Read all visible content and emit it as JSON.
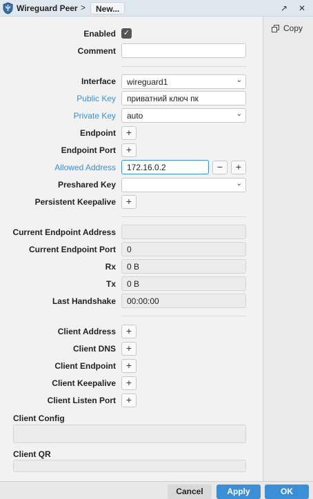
{
  "window": {
    "title": "Wireguard Peer",
    "separator": ">",
    "current": "New...",
    "detach_icon": "↗",
    "close_icon": "✕"
  },
  "sidebar": {
    "copy_label": "Copy"
  },
  "fields": {
    "enabled": {
      "label": "Enabled",
      "checked": true,
      "mark": "✓"
    },
    "comment": {
      "label": "Comment",
      "value": ""
    },
    "interface": {
      "label": "Interface",
      "value": "wireguard1"
    },
    "public_key": {
      "label": "Public Key",
      "value": "приватний ключ пк"
    },
    "private_key": {
      "label": "Private Key",
      "value": "auto"
    },
    "endpoint": {
      "label": "Endpoint"
    },
    "endpoint_port": {
      "label": "Endpoint Port"
    },
    "allowed_address": {
      "label": "Allowed Address",
      "value": "172.16.0.2"
    },
    "preshared_key": {
      "label": "Preshared Key",
      "value": ""
    },
    "persistent_keepalive": {
      "label": "Persistent Keepalive"
    },
    "current_endpoint_address": {
      "label": "Current Endpoint Address",
      "value": ""
    },
    "current_endpoint_port": {
      "label": "Current Endpoint Port",
      "value": "0"
    },
    "rx": {
      "label": "Rx",
      "value": "0 B"
    },
    "tx": {
      "label": "Tx",
      "value": "0 B"
    },
    "last_handshake": {
      "label": "Last Handshake",
      "value": "00:00:00"
    },
    "client_address": {
      "label": "Client Address"
    },
    "client_dns": {
      "label": "Client DNS"
    },
    "client_endpoint": {
      "label": "Client Endpoint"
    },
    "client_keepalive": {
      "label": "Client Keepalive"
    },
    "client_listen_port": {
      "label": "Client Listen Port"
    },
    "client_config": {
      "label": "Client Config"
    },
    "client_qr": {
      "label": "Client QR"
    }
  },
  "glyphs": {
    "plus": "+",
    "minus": "−",
    "caret": "⌄"
  },
  "footer": {
    "cancel": "Cancel",
    "apply": "Apply",
    "ok": "OK"
  },
  "colors": {
    "accent": "#3a8fd6",
    "titlebar": "#dfe7ef"
  }
}
